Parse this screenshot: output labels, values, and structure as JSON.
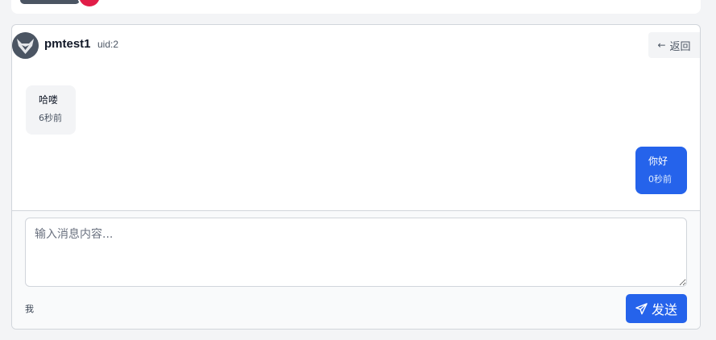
{
  "header": {
    "username": "pmtest1",
    "uid": "uid:2",
    "back_label": "返回"
  },
  "messages": [
    {
      "direction": "incoming",
      "text": "哈喽",
      "time": "6秒前"
    },
    {
      "direction": "outgoing",
      "text": "你好",
      "time": "0秒前"
    }
  ],
  "composer": {
    "placeholder": "输入消息内容...",
    "value": "",
    "self_label": "我",
    "send_label": "发送"
  },
  "icons": {
    "avatar": "horned-mask-icon",
    "back": "arrow-left-icon",
    "send": "paper-plane-icon"
  },
  "colors": {
    "accent": "#2563eb",
    "badge": "#e11d48"
  }
}
